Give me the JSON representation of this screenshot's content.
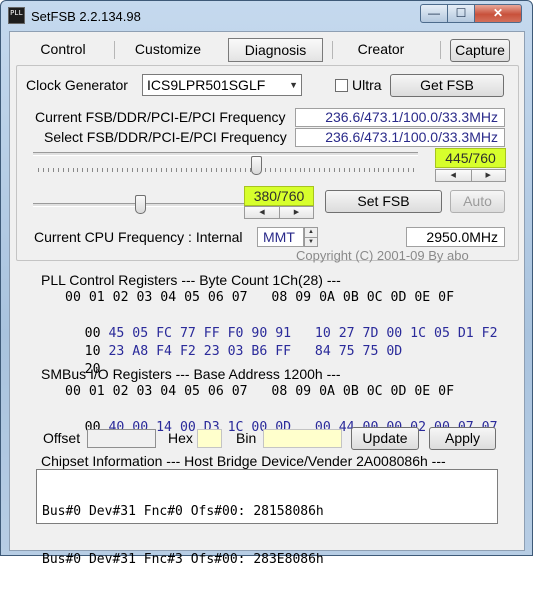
{
  "window": {
    "icon_text": "PLL",
    "title": "SetFSB 2.2.134.98",
    "minimize_glyph": "—",
    "maximize_glyph": "☐",
    "close_glyph": "✕"
  },
  "tabs": [
    {
      "label": "Control"
    },
    {
      "label": "Customize"
    },
    {
      "label": "Diagnosis",
      "active": true
    },
    {
      "label": "Creator"
    }
  ],
  "capture_button": "Capture",
  "clock_generator": {
    "label": "Clock Generator",
    "selected": "ICS9LPR501SGLF",
    "ultra_label": "Ultra",
    "ultra_checked": false,
    "get_fsb_button": "Get FSB"
  },
  "frequencies": {
    "current_label": "Current FSB/DDR/PCI-E/PCI Frequency",
    "current_value": "236.6/473.1/100.0/33.3MHz",
    "select_label": "Select FSB/DDR/PCI-E/PCI Frequency",
    "select_value": "236.6/473.1/100.0/33.3MHz"
  },
  "slider1": {
    "readout": "445/760",
    "value": 445,
    "max": 760
  },
  "slider2": {
    "readout": "380/760",
    "value": 380,
    "max": 760
  },
  "set_fsb_button": "Set FSB",
  "auto_button": "Auto",
  "cpu": {
    "label": "Current CPU Frequency : Internal",
    "mode": "MMT",
    "value": "2950.0MHz",
    "copyright": "Copyright (C) 2001-09 By abo"
  },
  "pll": {
    "title": "PLL Control Registers  --- Byte Count 1Ch(28) ---",
    "header": "00 01 02 03 04 05 06 07   08 09 0A 0B 0C 0D 0E 0F",
    "rows": [
      {
        "addr": "00",
        "values": "45 05 FC 77 FF F0 90 91   10 27 7D 00 1C 05 D1 F2"
      },
      {
        "addr": "10",
        "values": "23 A8 F4 F2 23 03 B6 FF   84 75 75 0D"
      },
      {
        "addr": "20",
        "values": ""
      }
    ]
  },
  "smbus": {
    "title": "SMBus I/O Registers  --- Base Address 1200h ---",
    "header": "00 01 02 03 04 05 06 07   08 09 0A 0B 0C 0D 0E 0F",
    "rows": [
      {
        "addr": "00",
        "values": "40 00 14 00 D3 1C 00 0D   00 44 00 00 02 00 07 07"
      }
    ],
    "offset_label": "Offset",
    "hex_label": "Hex",
    "bin_label": "Bin",
    "update_button": "Update",
    "apply_button": "Apply"
  },
  "chipset": {
    "title": "Chipset Information  --- Host Bridge Device/Vender 2A008086h ---",
    "lines": [
      "Bus#0 Dev#31 Fnc#0 Ofs#00: 28158086h",
      "Bus#0 Dev#31 Fnc#3 Ofs#00: 283E8086h"
    ]
  }
}
